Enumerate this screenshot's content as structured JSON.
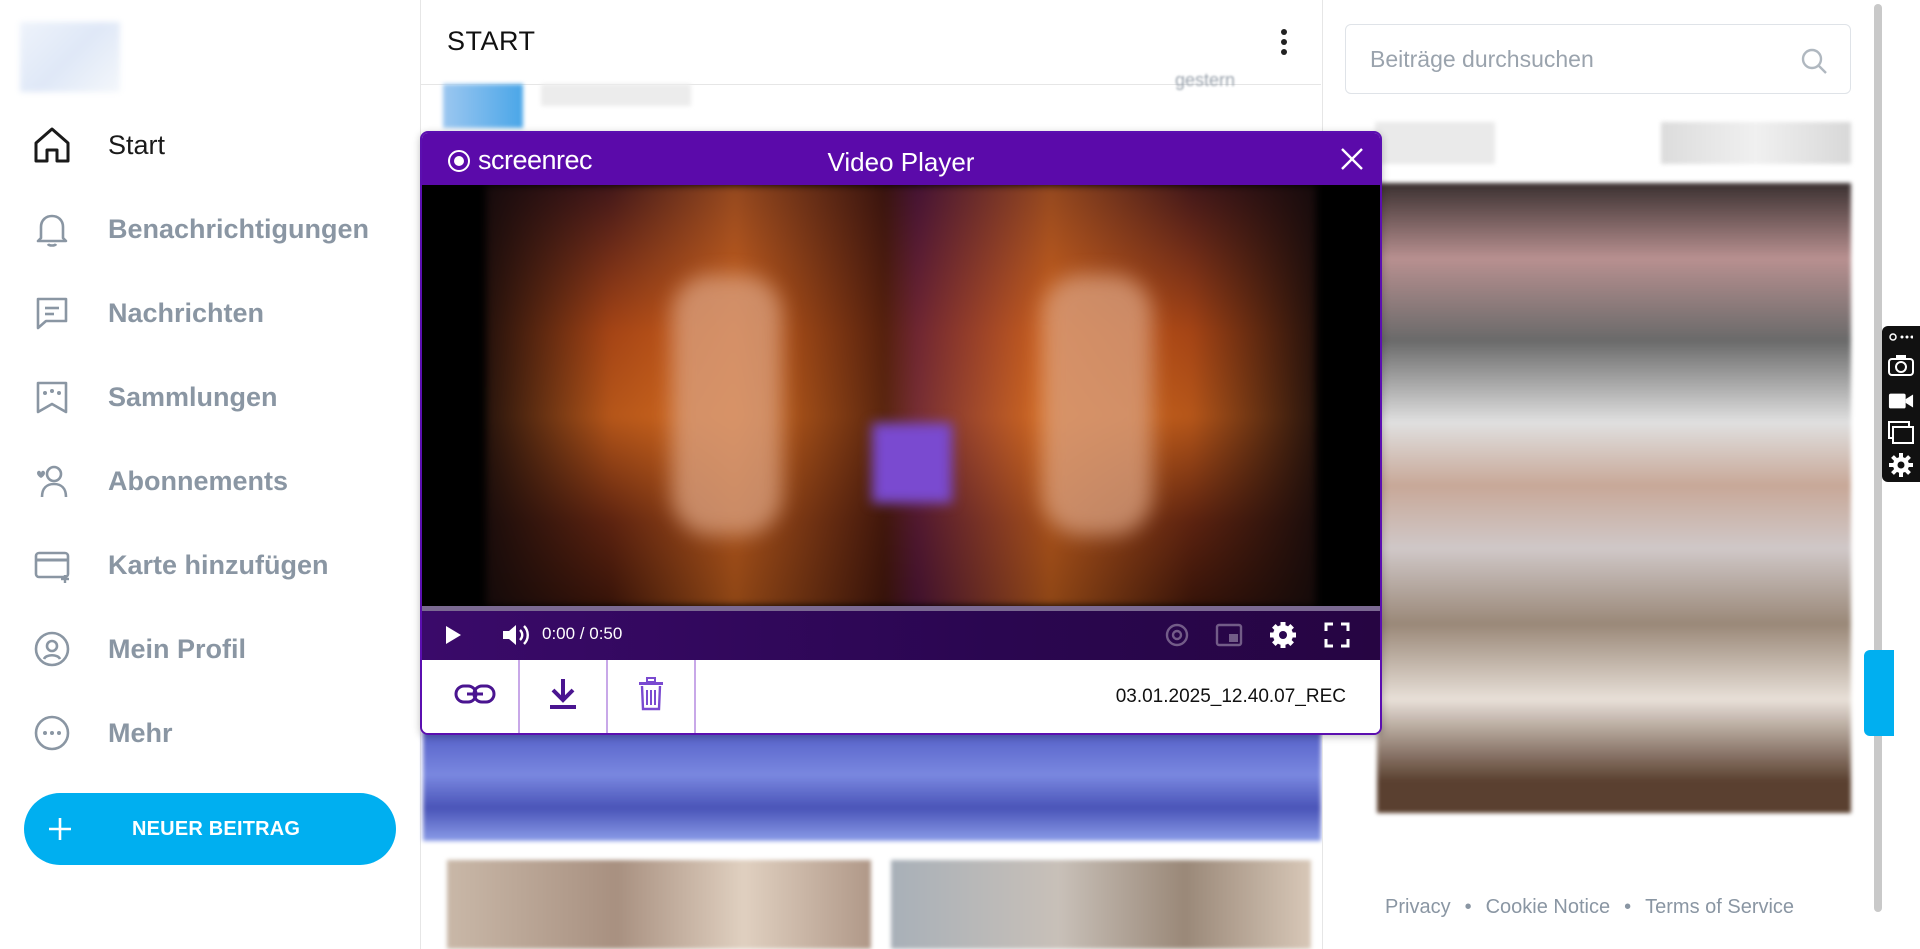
{
  "sidebar": {
    "items": [
      {
        "label": "Start",
        "icon": "home-icon"
      },
      {
        "label": "Benachrichtigungen",
        "icon": "bell-icon"
      },
      {
        "label": "Nachrichten",
        "icon": "message-icon"
      },
      {
        "label": "Sammlungen",
        "icon": "bookmark-stars-icon"
      },
      {
        "label": "Abonnements",
        "icon": "user-heart-icon"
      },
      {
        "label": "Karte hinzufügen",
        "icon": "card-add-icon"
      },
      {
        "label": "Mein Profil",
        "icon": "profile-icon"
      },
      {
        "label": "Mehr",
        "icon": "more-circle-icon"
      }
    ],
    "new_post_label": "NEUER BEITRAG"
  },
  "main": {
    "title": "START",
    "blurred_timestamp": "gestern"
  },
  "right": {
    "search_placeholder": "Beiträge durchsuchen",
    "footer": [
      "Privacy",
      "Cookie Notice",
      "Terms of Service"
    ],
    "footer_separator": "•"
  },
  "player": {
    "brand": "screenrec",
    "title": "Video Player",
    "time": "0:00 / 0:50",
    "progress": 0,
    "filename": "03.01.2025_12.40.07_REC"
  },
  "colors": {
    "accent": "#00aff0",
    "player_purple": "#5b0aaa",
    "nav_inactive": "#8a96a3"
  }
}
